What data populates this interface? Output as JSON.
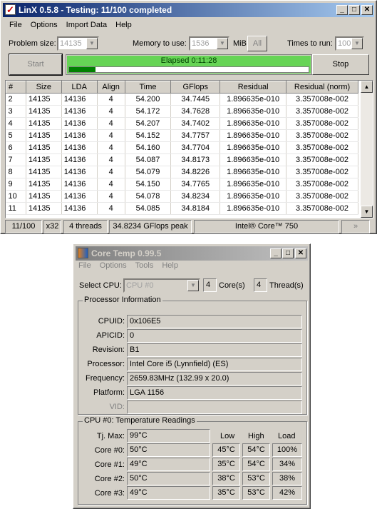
{
  "linx": {
    "title": "LinX 0.5.8 - Testing: 11/100 completed",
    "menu": [
      "File",
      "Options",
      "Import Data",
      "Help"
    ],
    "problem_size_label": "Problem size:",
    "problem_size": "14135",
    "memory_label": "Memory to use:",
    "memory": "1536",
    "mib": "MiB",
    "all_label": "All",
    "times_label": "Times to run:",
    "times": "100",
    "start_label": "Start",
    "stop_label": "Stop",
    "elapsed": "Elapsed 0:11:28",
    "progress_fraction": 0.11,
    "columns": [
      "#",
      "Size",
      "LDA",
      "Align",
      "Time",
      "GFlops",
      "Residual",
      "Residual (norm)"
    ],
    "rows": [
      [
        "2",
        "14135",
        "14136",
        "4",
        "54.200",
        "34.7445",
        "1.896635e-010",
        "3.357008e-002"
      ],
      [
        "3",
        "14135",
        "14136",
        "4",
        "54.172",
        "34.7628",
        "1.896635e-010",
        "3.357008e-002"
      ],
      [
        "4",
        "14135",
        "14136",
        "4",
        "54.207",
        "34.7402",
        "1.896635e-010",
        "3.357008e-002"
      ],
      [
        "5",
        "14135",
        "14136",
        "4",
        "54.152",
        "34.7757",
        "1.896635e-010",
        "3.357008e-002"
      ],
      [
        "6",
        "14135",
        "14136",
        "4",
        "54.160",
        "34.7704",
        "1.896635e-010",
        "3.357008e-002"
      ],
      [
        "7",
        "14135",
        "14136",
        "4",
        "54.087",
        "34.8173",
        "1.896635e-010",
        "3.357008e-002"
      ],
      [
        "8",
        "14135",
        "14136",
        "4",
        "54.079",
        "34.8226",
        "1.896635e-010",
        "3.357008e-002"
      ],
      [
        "9",
        "14135",
        "14136",
        "4",
        "54.150",
        "34.7765",
        "1.896635e-010",
        "3.357008e-002"
      ],
      [
        "10",
        "14135",
        "14136",
        "4",
        "54.078",
        "34.8234",
        "1.896635e-010",
        "3.357008e-002"
      ],
      [
        "11",
        "14135",
        "14136",
        "4",
        "54.085",
        "34.8184",
        "1.896635e-010",
        "3.357008e-002"
      ]
    ],
    "status": [
      "11/100",
      "x32",
      "4 threads",
      "34.8234 GFlops peak",
      "Intel® Core™ 750",
      "»"
    ]
  },
  "coretemp": {
    "title": "Core Temp 0.99.5",
    "menu": [
      "File",
      "Options",
      "Tools",
      "Help"
    ],
    "select_cpu_label": "Select CPU:",
    "cpu": "CPU #0",
    "cores": "4",
    "cores_label": "Core(s)",
    "threads": "4",
    "threads_label": "Thread(s)",
    "proc_group": "Processor Information",
    "proc": [
      [
        "CPUID:",
        "0x106E5"
      ],
      [
        "APICID:",
        "0"
      ],
      [
        "Revision:",
        "B1"
      ],
      [
        "Processor:",
        "Intel Core i5 (Lynnfield) (ES)"
      ],
      [
        "Frequency:",
        "2659.83MHz (132.99 x 20.0)"
      ],
      [
        "Platform:",
        "LGA 1156"
      ],
      [
        "VID:",
        ""
      ]
    ],
    "temp_group": "CPU #0: Temperature Readings",
    "tjmax_label": "Tj. Max:",
    "tjmax": "99°C",
    "headers": [
      "Low",
      "High",
      "Load"
    ],
    "cores_rows": [
      [
        "Core #0:",
        "50°C",
        "45°C",
        "54°C",
        "100%"
      ],
      [
        "Core #1:",
        "49°C",
        "35°C",
        "54°C",
        "34%"
      ],
      [
        "Core #2:",
        "50°C",
        "38°C",
        "53°C",
        "38%"
      ],
      [
        "Core #3:",
        "49°C",
        "35°C",
        "53°C",
        "42%"
      ]
    ]
  },
  "colors": {
    "progress": "#66d455",
    "progress_fill": "#008000",
    "linx_title_start": "#0a246a",
    "linx_title_end": "#a6caf0"
  }
}
